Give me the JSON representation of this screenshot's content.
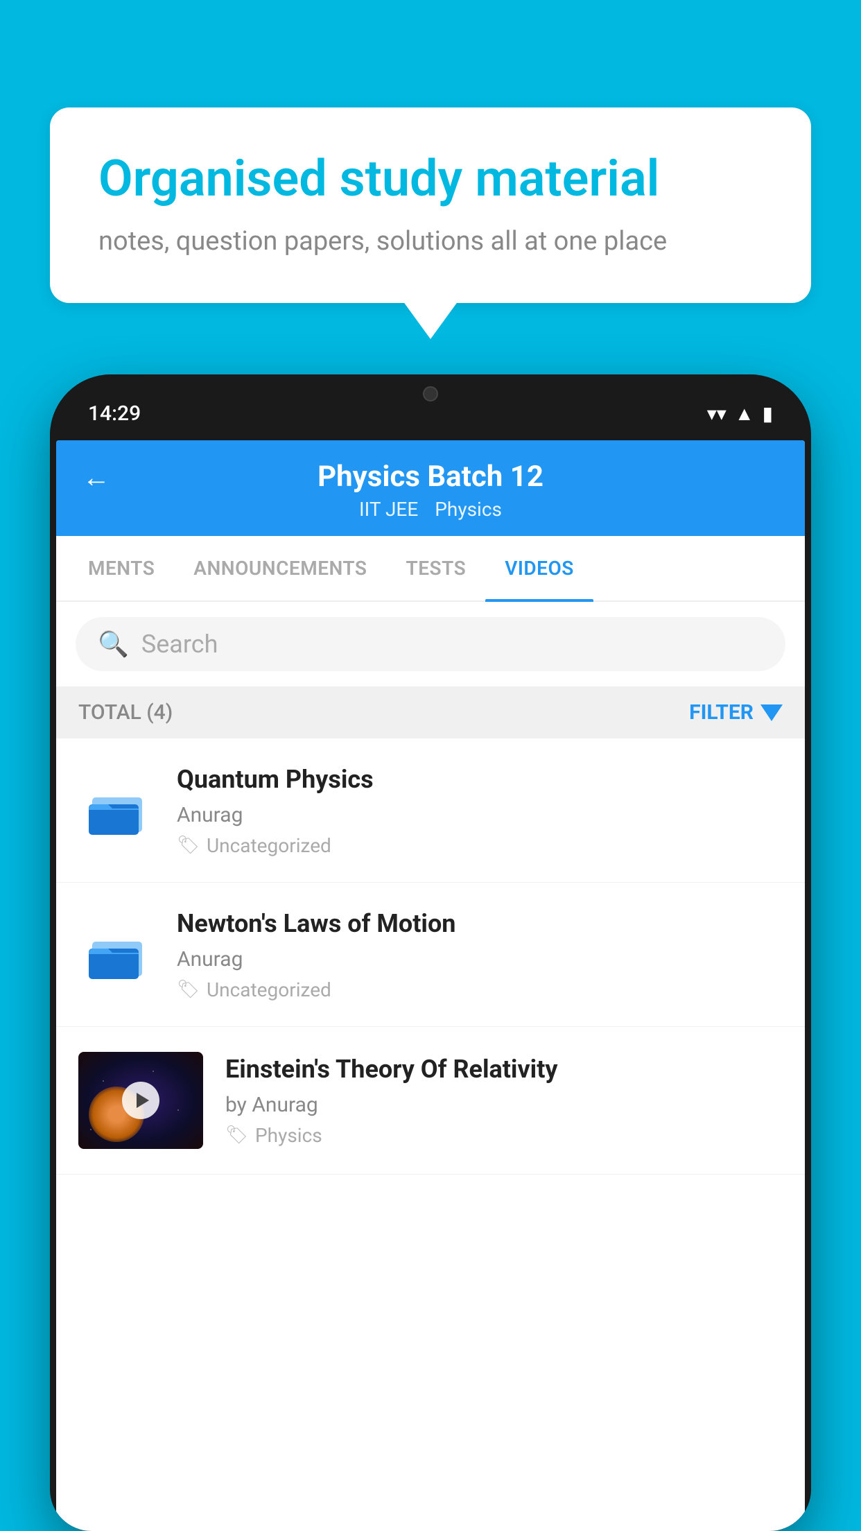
{
  "background_color": "#00b8e0",
  "speech_bubble": {
    "title": "Organised study material",
    "subtitle": "notes, question papers, solutions all at one place"
  },
  "phone": {
    "status_bar": {
      "time": "14:29",
      "icons": [
        "wifi",
        "signal",
        "battery"
      ]
    },
    "header": {
      "back_label": "←",
      "title": "Physics Batch 12",
      "subtitle_left": "IIT JEE",
      "subtitle_right": "Physics"
    },
    "tabs": [
      {
        "label": "MENTS",
        "active": false
      },
      {
        "label": "ANNOUNCEMENTS",
        "active": false
      },
      {
        "label": "TESTS",
        "active": false
      },
      {
        "label": "VIDEOS",
        "active": true
      }
    ],
    "search": {
      "placeholder": "Search"
    },
    "filter_bar": {
      "total_label": "TOTAL (4)",
      "filter_label": "FILTER"
    },
    "videos": [
      {
        "title": "Quantum Physics",
        "author": "Anurag",
        "tag": "Uncategorized",
        "type": "folder",
        "has_thumbnail": false
      },
      {
        "title": "Newton's Laws of Motion",
        "author": "Anurag",
        "tag": "Uncategorized",
        "type": "folder",
        "has_thumbnail": false
      },
      {
        "title": "Einstein's Theory Of Relativity",
        "author": "by Anurag",
        "tag": "Physics",
        "type": "video",
        "has_thumbnail": true
      }
    ]
  }
}
